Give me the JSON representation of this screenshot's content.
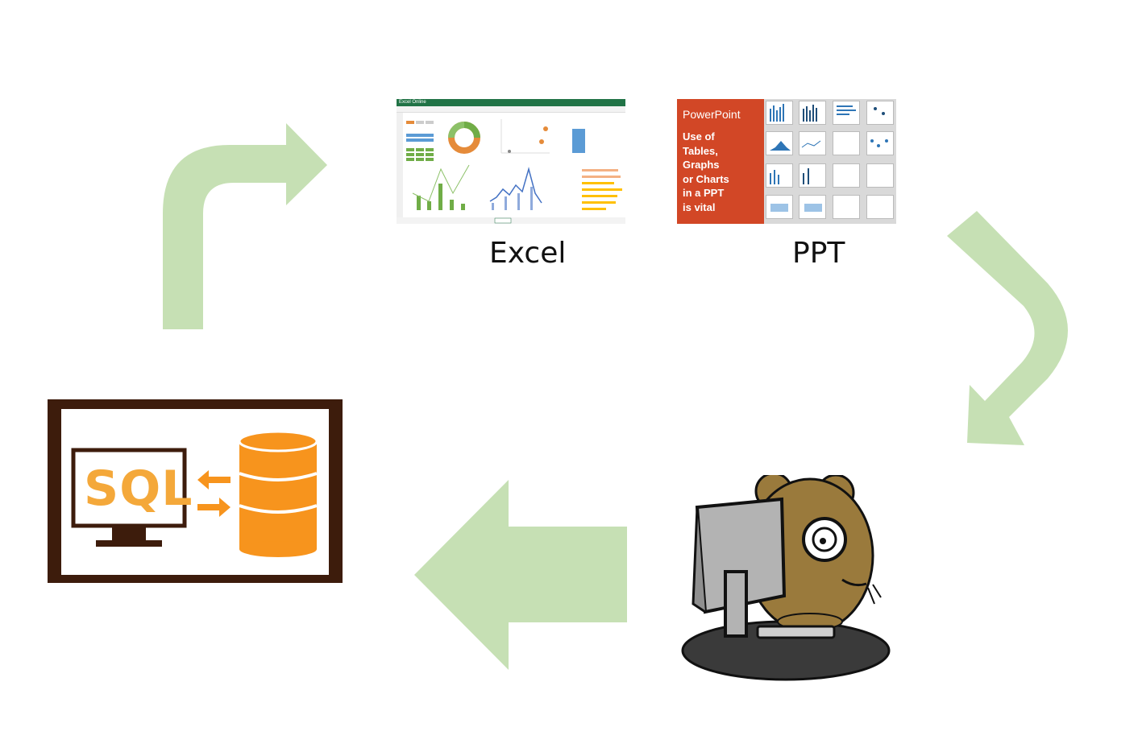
{
  "captions": {
    "excel": "Excel",
    "ppt": "PPT"
  },
  "excel_thumb": {
    "app_title": "Excel Online"
  },
  "ppt_thumb": {
    "title": "PowerPoint",
    "body": "Use of\nTables,\nGraphs\nor Charts\nin a PPT\nis vital"
  },
  "sql_box": {
    "label": "SQL"
  },
  "colors": {
    "arrow_green": "#c6e0b4",
    "excel_green": "#217346",
    "ppt_red": "#d24726",
    "sql_orange": "#f4a83a",
    "db_orange": "#f7941d",
    "frame_brown": "#3d1c0c"
  }
}
